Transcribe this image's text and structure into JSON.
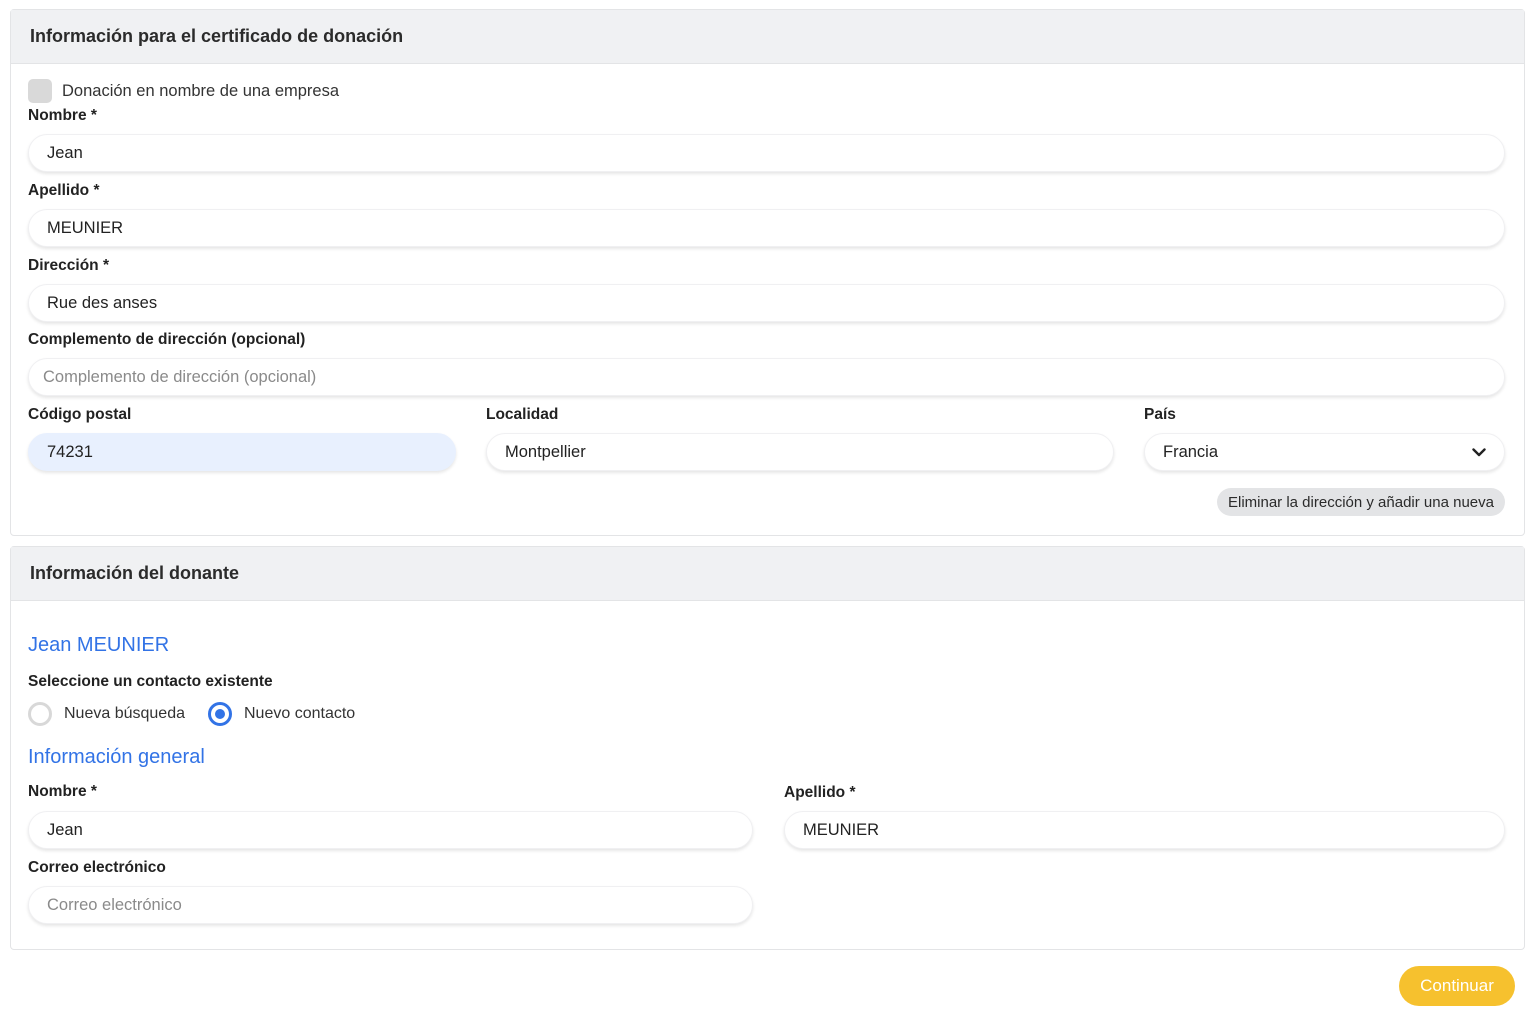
{
  "certificate": {
    "title": "Información para el certificado de donación",
    "company_checkbox_label": "Donación en nombre de una empresa",
    "first_name": {
      "label": "Nombre *",
      "value": "Jean"
    },
    "last_name": {
      "label": "Apellido *",
      "value": "MEUNIER"
    },
    "address": {
      "label": "Dirección *",
      "value": "Rue des anses"
    },
    "address_complement": {
      "label": "Complemento de dirección (opcional)",
      "value": "",
      "placeholder": "Complemento de dirección (opcional)"
    },
    "postal_code": {
      "label": "Código postal",
      "value": "74231"
    },
    "city": {
      "label": "Localidad",
      "value": "Montpellier"
    },
    "country": {
      "label": "País",
      "selected": "Francia"
    },
    "delete_address_label": "Eliminar la dirección y añadir una nueva"
  },
  "donor": {
    "title": "Información del donante",
    "full_name": "Jean MEUNIER",
    "select_contact_label": "Seleccione un contacto existente",
    "options": [
      {
        "label": "Nueva búsqueda",
        "checked": false
      },
      {
        "label": "Nuevo contacto",
        "checked": true
      }
    ],
    "general_info_heading": "Información general",
    "first_name": {
      "label": "Nombre *",
      "value": "Jean"
    },
    "last_name": {
      "label": "Apellido *",
      "value": "MEUNIER"
    },
    "email": {
      "label": "Correo electrónico",
      "value": "",
      "placeholder": "Correo electrónico"
    }
  },
  "continue_label": "Continuar",
  "colors": {
    "accent_blue": "#3273e6",
    "continue_yellow": "#f6c12e",
    "header_bg": "#f0f1f3"
  }
}
